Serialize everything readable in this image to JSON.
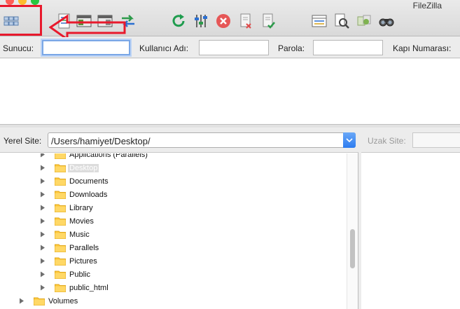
{
  "window": {
    "title": "FileZilla",
    "traffic_colors": [
      "#fe5f57",
      "#febc2e",
      "#28c840"
    ]
  },
  "toolbar": {
    "buttons": [
      {
        "name": "site-manager-icon"
      },
      {
        "name": "message-log-icon"
      },
      {
        "name": "local-tree-icon"
      },
      {
        "name": "remote-tree-icon"
      },
      {
        "name": "transfer-queue-icon"
      },
      {
        "name": "refresh-icon"
      },
      {
        "name": "process-queue-icon"
      },
      {
        "name": "cancel-icon"
      },
      {
        "name": "disconnect-icon"
      },
      {
        "name": "reconnect-icon"
      },
      {
        "name": "directory-listing-filter-icon"
      },
      {
        "name": "compare-directories-icon"
      },
      {
        "name": "sync-browsing-icon"
      },
      {
        "name": "search-files-icon"
      }
    ]
  },
  "annotation": {
    "color": "#e8192c"
  },
  "quickconnect": {
    "host_label": "Sunucu:",
    "host_value": "",
    "user_label": "Kullanıcı Adı:",
    "user_value": "",
    "pass_label": "Parola:",
    "pass_value": "",
    "port_label": "Kapı Numarası:"
  },
  "local": {
    "label": "Yerel Site:",
    "path": "/Users/hamiyet/Desktop/",
    "tree": [
      {
        "name": "Applications (Parallels)",
        "level": 1,
        "expandable": true
      },
      {
        "name": "Desktop",
        "level": 1,
        "expandable": true,
        "selected": true
      },
      {
        "name": "Documents",
        "level": 1,
        "expandable": true
      },
      {
        "name": "Downloads",
        "level": 1,
        "expandable": true
      },
      {
        "name": "Library",
        "level": 1,
        "expandable": true
      },
      {
        "name": "Movies",
        "level": 1,
        "expandable": true
      },
      {
        "name": "Music",
        "level": 1,
        "expandable": true
      },
      {
        "name": "Parallels",
        "level": 1,
        "expandable": true
      },
      {
        "name": "Pictures",
        "level": 1,
        "expandable": true
      },
      {
        "name": "Public",
        "level": 1,
        "expandable": true
      },
      {
        "name": "public_html",
        "level": 1,
        "expandable": true
      },
      {
        "name": "Volumes",
        "level": 0,
        "expandable": true
      }
    ]
  },
  "remote": {
    "label": "Uzak Site:"
  }
}
